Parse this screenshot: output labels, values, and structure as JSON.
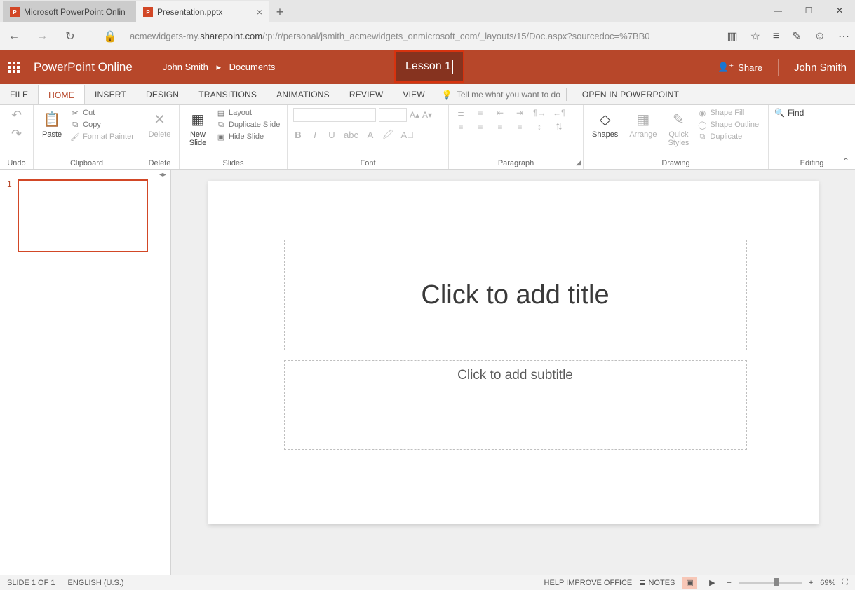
{
  "browser": {
    "tabs": [
      {
        "title": "Microsoft PowerPoint Onlin"
      },
      {
        "title": "Presentation.pptx"
      }
    ],
    "url_pre": "acmewidgets-my.",
    "url_host": "sharepoint.com",
    "url_post": "/:p:/r/personal/jsmith_acmewidgets_onmicrosoft_com/_layouts/15/Doc.aspx?sourcedoc=%7BB0"
  },
  "header": {
    "app": "PowerPoint Online",
    "user_path_1": "John Smith",
    "user_path_2": "Documents",
    "filename": "Lesson 1",
    "share": "Share",
    "user": "John Smith"
  },
  "ribbon_tabs": {
    "file": "FILE",
    "home": "HOME",
    "insert": "INSERT",
    "design": "DESIGN",
    "transitions": "TRANSITIONS",
    "animations": "ANIMATIONS",
    "review": "REVIEW",
    "view": "VIEW",
    "tell_me": "Tell me what you want to do",
    "open_pp": "OPEN IN POWERPOINT"
  },
  "ribbon": {
    "undo": {
      "label": "Undo"
    },
    "clipboard": {
      "paste": "Paste",
      "cut": "Cut",
      "copy": "Copy",
      "format_painter": "Format Painter",
      "label": "Clipboard"
    },
    "delete": {
      "btn": "Delete",
      "label": "Delete"
    },
    "slides": {
      "new_slide": "New\nSlide",
      "layout": "Layout",
      "duplicate": "Duplicate Slide",
      "hide": "Hide Slide",
      "label": "Slides"
    },
    "font": {
      "label": "Font"
    },
    "paragraph": {
      "label": "Paragraph"
    },
    "drawing": {
      "shapes": "Shapes",
      "arrange": "Arrange",
      "quick": "Quick\nStyles",
      "fill": "Shape Fill",
      "outline": "Shape Outline",
      "duplicate": "Duplicate",
      "label": "Drawing"
    },
    "editing": {
      "find": "Find",
      "label": "Editing"
    }
  },
  "thumb": {
    "num": "1"
  },
  "slide": {
    "title_placeholder": "Click to add title",
    "subtitle_placeholder": "Click to add subtitle"
  },
  "status": {
    "slide": "SLIDE 1 OF 1",
    "lang": "ENGLISH (U.S.)",
    "help": "HELP IMPROVE OFFICE",
    "notes": "NOTES",
    "zoom": "69%"
  }
}
